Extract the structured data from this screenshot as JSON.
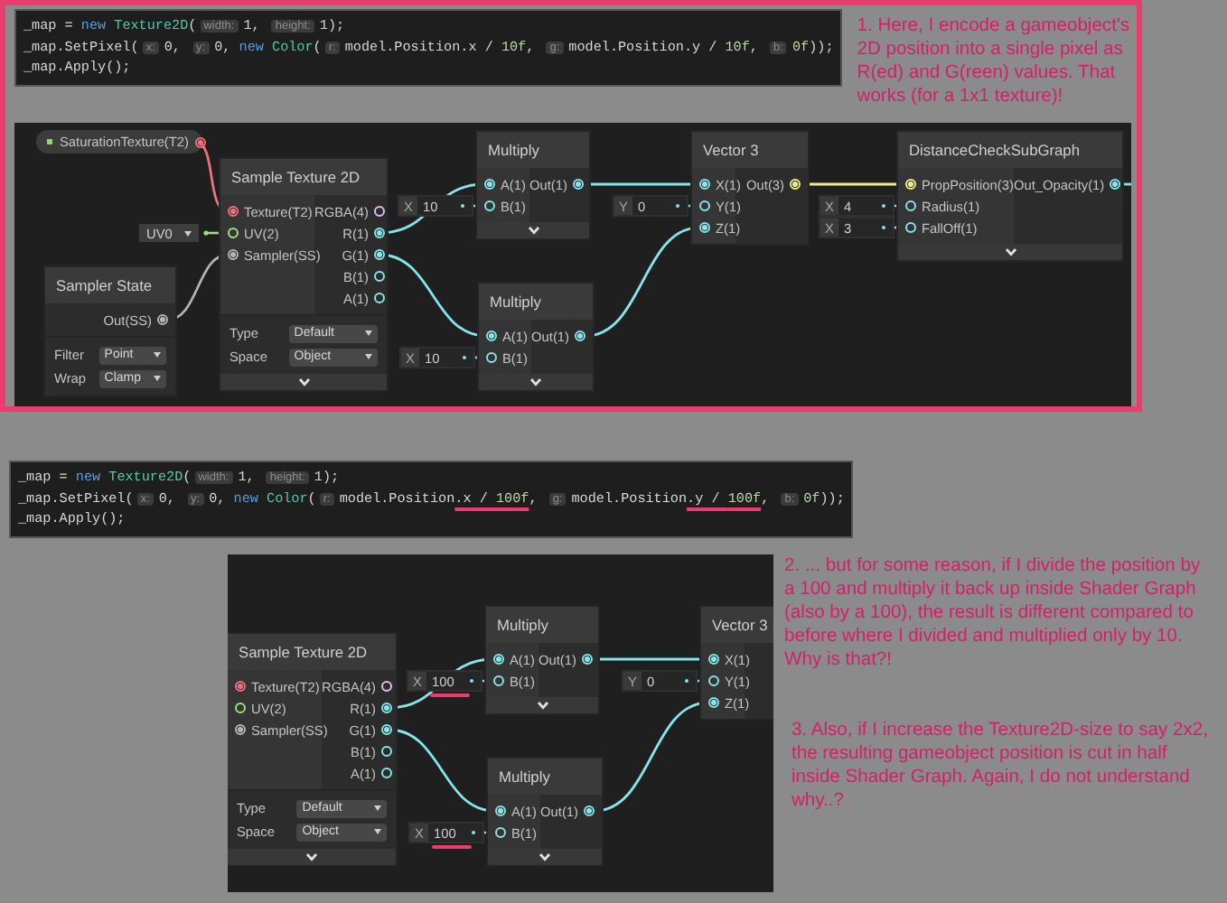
{
  "code_snippets": [
    {
      "lines": [
        {
          "tokens": [
            {
              "kind": "plain",
              "text": "_map = "
            },
            {
              "kind": "keyword",
              "text": "new"
            },
            {
              "kind": "type",
              "text": " Texture2D"
            },
            {
              "kind": "plain",
              "text": "("
            },
            {
              "kind": "hint",
              "text": "width:"
            },
            {
              "kind": "plain",
              "text": "1, "
            },
            {
              "kind": "hint",
              "text": "height:"
            },
            {
              "kind": "plain",
              "text": "1);"
            }
          ]
        },
        {
          "tokens": [
            {
              "kind": "plain",
              "text": "_map.SetPixel("
            },
            {
              "kind": "hint",
              "text": "x:"
            },
            {
              "kind": "plain",
              "text": "0, "
            },
            {
              "kind": "hint",
              "text": "y:"
            },
            {
              "kind": "plain",
              "text": "0, "
            },
            {
              "kind": "keyword",
              "text": "new"
            },
            {
              "kind": "type",
              "text": " Color"
            },
            {
              "kind": "plain",
              "text": "("
            },
            {
              "kind": "hint",
              "text": "r:"
            },
            {
              "kind": "plain",
              "text": "model.Position.x / "
            },
            {
              "kind": "number",
              "text": "10f"
            },
            {
              "kind": "plain",
              "text": ", "
            },
            {
              "kind": "hint",
              "text": "g:"
            },
            {
              "kind": "plain",
              "text": "model.Position.y / "
            },
            {
              "kind": "number",
              "text": "10f"
            },
            {
              "kind": "plain",
              "text": ", "
            },
            {
              "kind": "hint",
              "text": "b:"
            },
            {
              "kind": "number",
              "text": "0f"
            },
            {
              "kind": "plain",
              "text": "));"
            }
          ]
        },
        {
          "tokens": [
            {
              "kind": "plain",
              "text": "_map.Apply();"
            }
          ]
        }
      ]
    },
    {
      "lines": [
        {
          "tokens": [
            {
              "kind": "plain",
              "text": "_map = "
            },
            {
              "kind": "keyword",
              "text": "new"
            },
            {
              "kind": "type",
              "text": " Texture2D"
            },
            {
              "kind": "plain",
              "text": "("
            },
            {
              "kind": "hint",
              "text": "width:"
            },
            {
              "kind": "plain",
              "text": "1, "
            },
            {
              "kind": "hint",
              "text": "height:"
            },
            {
              "kind": "plain",
              "text": "1);"
            }
          ]
        },
        {
          "tokens": [
            {
              "kind": "plain",
              "text": "_map.SetPixel("
            },
            {
              "kind": "hint",
              "text": "x:"
            },
            {
              "kind": "plain",
              "text": "0, "
            },
            {
              "kind": "hint",
              "text": "y:"
            },
            {
              "kind": "plain",
              "text": "0, "
            },
            {
              "kind": "keyword",
              "text": "new"
            },
            {
              "kind": "type",
              "text": " Color"
            },
            {
              "kind": "plain",
              "text": "("
            },
            {
              "kind": "hint",
              "text": "r:"
            },
            {
              "kind": "plain",
              "text": "model.Position"
            },
            {
              "kind": "plain",
              "text": ".x / ",
              "underlined": true
            },
            {
              "kind": "number",
              "text": "100f",
              "underlined": true
            },
            {
              "kind": "plain",
              "text": ", "
            },
            {
              "kind": "hint",
              "text": "g:"
            },
            {
              "kind": "plain",
              "text": "model.Position"
            },
            {
              "kind": "plain",
              "text": ".y / ",
              "underlined": true
            },
            {
              "kind": "number",
              "text": "100f",
              "underlined": true
            },
            {
              "kind": "plain",
              "text": ", "
            },
            {
              "kind": "hint",
              "text": "b:"
            },
            {
              "kind": "number",
              "text": "0f"
            },
            {
              "kind": "plain",
              "text": "));"
            }
          ]
        },
        {
          "tokens": [
            {
              "kind": "plain",
              "text": "_map.Apply();"
            }
          ]
        }
      ]
    }
  ],
  "graphs": [
    {
      "properties": [
        {
          "label": "SaturationTexture(T2)",
          "kind": "texture"
        }
      ],
      "nodes": [
        {
          "title": "Sample Texture 2D",
          "inputs": [
            {
              "label": "Texture(T2)",
              "kind": "texture",
              "connected": true
            },
            {
              "label": "UV(2)",
              "kind": "uv",
              "connected": false,
              "default": {
                "kind": "dropdown",
                "value": "UV0"
              }
            },
            {
              "label": "Sampler(SS)",
              "kind": "sampler",
              "connected": true
            }
          ],
          "outputs": [
            {
              "label": "RGBA(4)",
              "kind": "vector4",
              "connected": false
            },
            {
              "label": "R(1)",
              "kind": "float",
              "connected": true
            },
            {
              "label": "G(1)",
              "kind": "float",
              "connected": true
            },
            {
              "label": "B(1)",
              "kind": "float",
              "connected": false
            },
            {
              "label": "A(1)",
              "kind": "float",
              "connected": false
            }
          ],
          "settings": [
            {
              "label": "Type",
              "value": "Default"
            },
            {
              "label": "Space",
              "value": "Object"
            }
          ],
          "expander": true
        },
        {
          "title": "Sampler State",
          "outputs": [
            {
              "label": "Out(SS)",
              "kind": "sampler",
              "connected": true
            }
          ],
          "settings": [
            {
              "label": "Filter",
              "value": "Point"
            },
            {
              "label": "Wrap",
              "value": "Clamp"
            }
          ],
          "expander": false
        },
        {
          "title": "Multiply",
          "inputs": [
            {
              "label": "A(1)",
              "kind": "float",
              "connected": true
            },
            {
              "label": "B(1)",
              "kind": "float",
              "connected": false,
              "default": {
                "kind": "vector",
                "axis": "X",
                "value": "10",
                "underlined": false
              }
            }
          ],
          "outputs": [
            {
              "label": "Out(1)",
              "kind": "float",
              "connected": true
            }
          ],
          "expander": true
        },
        {
          "title": "Multiply",
          "inputs": [
            {
              "label": "A(1)",
              "kind": "float",
              "connected": true
            },
            {
              "label": "B(1)",
              "kind": "float",
              "connected": false,
              "default": {
                "kind": "vector",
                "axis": "X",
                "value": "10",
                "underlined": false
              }
            }
          ],
          "outputs": [
            {
              "label": "Out(1)",
              "kind": "float",
              "connected": true
            }
          ],
          "expander": true
        },
        {
          "title": "Vector 3",
          "inputs": [
            {
              "label": "X(1)",
              "kind": "float",
              "connected": true
            },
            {
              "label": "Y(1)",
              "kind": "float",
              "connected": false,
              "default": {
                "kind": "vector",
                "axis": "Y",
                "value": "0",
                "underlined": false
              }
            },
            {
              "label": "Z(1)",
              "kind": "float",
              "connected": true
            }
          ],
          "outputs": [
            {
              "label": "Out(3)",
              "kind": "vector3",
              "connected": true
            }
          ],
          "expander": false
        },
        {
          "title": "DistanceCheckSubGraph",
          "inputs": [
            {
              "label": "PropPosition(3)",
              "kind": "vector3",
              "connected": true
            },
            {
              "label": "Radius(1)",
              "kind": "float",
              "connected": false,
              "default": {
                "kind": "vector",
                "axis": "X",
                "value": "4",
                "underlined": false
              }
            },
            {
              "label": "FallOff(1)",
              "kind": "float",
              "connected": false,
              "default": {
                "kind": "vector",
                "axis": "X",
                "value": "3",
                "underlined": false
              }
            }
          ],
          "outputs": [
            {
              "label": "Out_Opacity(1)",
              "kind": "float",
              "connected": true
            }
          ],
          "expander": true
        }
      ]
    },
    {
      "nodes": [
        {
          "title": "Sample Texture 2D",
          "inputs": [
            {
              "label": "Texture(T2)",
              "kind": "texture",
              "connected": true
            },
            {
              "label": "UV(2)",
              "kind": "uv",
              "connected": false
            },
            {
              "label": "Sampler(SS)",
              "kind": "sampler",
              "connected": true
            }
          ],
          "outputs": [
            {
              "label": "RGBA(4)",
              "kind": "vector4",
              "connected": false
            },
            {
              "label": "R(1)",
              "kind": "float",
              "connected": true
            },
            {
              "label": "G(1)",
              "kind": "float",
              "connected": true
            },
            {
              "label": "B(1)",
              "kind": "float",
              "connected": false
            },
            {
              "label": "A(1)",
              "kind": "float",
              "connected": false
            }
          ],
          "settings": [
            {
              "label": "Type",
              "value": "Default"
            },
            {
              "label": "Space",
              "value": "Object"
            }
          ],
          "expander": true
        },
        {
          "title": "Multiply",
          "inputs": [
            {
              "label": "A(1)",
              "kind": "float",
              "connected": true
            },
            {
              "label": "B(1)",
              "kind": "float",
              "connected": false,
              "default": {
                "kind": "vector",
                "axis": "X",
                "value": "100",
                "underlined": true
              }
            }
          ],
          "outputs": [
            {
              "label": "Out(1)",
              "kind": "float",
              "connected": true
            }
          ],
          "expander": true
        },
        {
          "title": "Multiply",
          "inputs": [
            {
              "label": "A(1)",
              "kind": "float",
              "connected": true
            },
            {
              "label": "B(1)",
              "kind": "float",
              "connected": false,
              "default": {
                "kind": "vector",
                "axis": "X",
                "value": "100",
                "underlined": true
              }
            }
          ],
          "outputs": [
            {
              "label": "Out(1)",
              "kind": "float",
              "connected": true
            }
          ],
          "expander": true
        },
        {
          "title": "Vector 3",
          "inputs": [
            {
              "label": "X(1)",
              "kind": "float",
              "connected": true
            },
            {
              "label": "Y(1)",
              "kind": "float",
              "connected": false,
              "default": {
                "kind": "vector",
                "axis": "Y",
                "value": "0",
                "underlined": false
              }
            },
            {
              "label": "Z(1)",
              "kind": "float",
              "connected": true
            }
          ],
          "expander": false
        }
      ]
    }
  ],
  "notes": [
    "1. Here, I encode a gameobject's 2D position into a single pixel as R(ed) and G(reen) values. That works (for a 1x1 texture)!",
    "2. ... but for some reason, if I divide the position by a 100 and multiply it back up inside Shader Graph (also by a 100), the result is different compared to before where I divided and multiplied only by 10. Why is that?!",
    "3. Also, if I increase the Texture2D-size to say 2x2, the resulting gameobject position is cut in half inside Shader Graph. Again, I do not understand why..?"
  ]
}
